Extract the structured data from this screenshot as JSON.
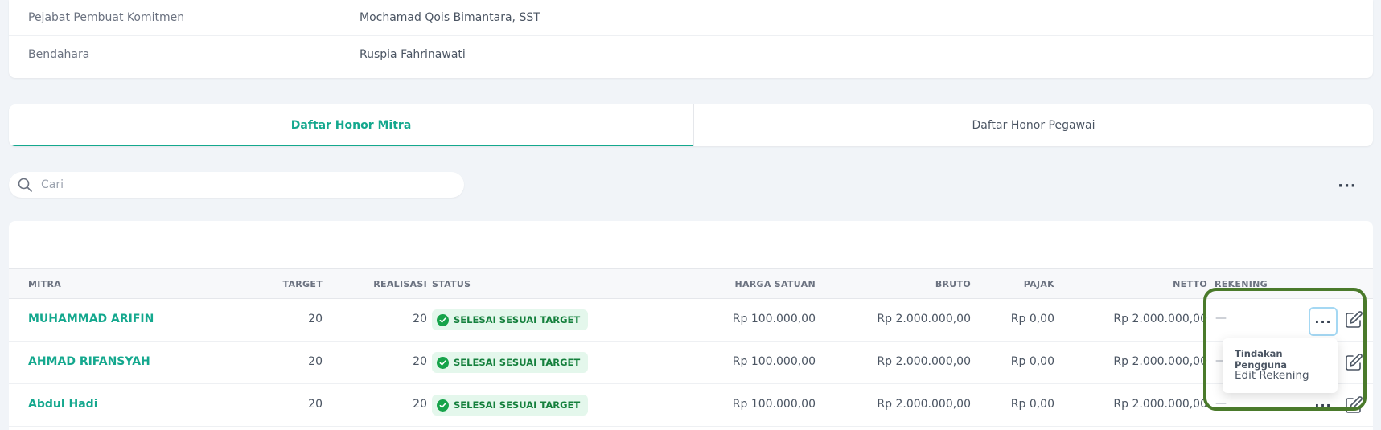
{
  "info": {
    "rows": [
      {
        "label": "Pejabat Pembuat Komitmen",
        "value": "Mochamad Qois Bimantara, SST"
      },
      {
        "label": "Bendahara",
        "value": "Ruspia Fahrinawati"
      }
    ]
  },
  "tabs": [
    {
      "label": "Daftar Honor Mitra",
      "active": true
    },
    {
      "label": "Daftar Honor Pegawai",
      "active": false
    }
  ],
  "search": {
    "placeholder": "Cari"
  },
  "icons": {
    "search": "search-icon",
    "more": "more-horizontal-icon",
    "edit": "edit-icon",
    "check": "check-circle-icon"
  },
  "colors": {
    "accent": "#14a88e",
    "badge_bg": "#e4f7ec",
    "badge_text": "#15803d",
    "highlight": "#4a7a2b"
  },
  "table": {
    "headers": {
      "mitra": "MITRA",
      "target": "TARGET",
      "realisasi": "REALISASI",
      "status": "STATUS",
      "harga_satuan": "HARGA SATUAN",
      "bruto": "BRUTO",
      "pajak": "PAJAK",
      "netto": "NETTO",
      "rekening": "REKENING"
    },
    "rows": [
      {
        "mitra": "MUHAMMAD ARIFIN",
        "target": "20",
        "realisasi": "20",
        "status": "SELESAI SESUAI TARGET",
        "harga_satuan": "Rp 100.000,00",
        "bruto": "Rp 2.000.000,00",
        "pajak": "Rp 0,00",
        "netto": "Rp 2.000.000,00",
        "rekening": "—",
        "more": "···"
      },
      {
        "mitra": "AHMAD RIFANSYAH",
        "target": "20",
        "realisasi": "20",
        "status": "SELESAI SESUAI TARGET",
        "harga_satuan": "Rp 100.000,00",
        "bruto": "Rp 2.000.000,00",
        "pajak": "Rp 0,00",
        "netto": "Rp 2.000.000,00",
        "rekening": "—"
      },
      {
        "mitra": "Abdul Hadi",
        "target": "20",
        "realisasi": "20",
        "status": "SELESAI SESUAI TARGET",
        "harga_satuan": "Rp 100.000,00",
        "bruto": "Rp 2.000.000,00",
        "pajak": "Rp 0,00",
        "netto": "Rp 2.000.000,00",
        "rekening": "—",
        "more": "···"
      }
    ]
  },
  "more_top": "···",
  "dropdown": {
    "title": "Tindakan Pengguna",
    "items": [
      "Edit Rekening"
    ]
  }
}
